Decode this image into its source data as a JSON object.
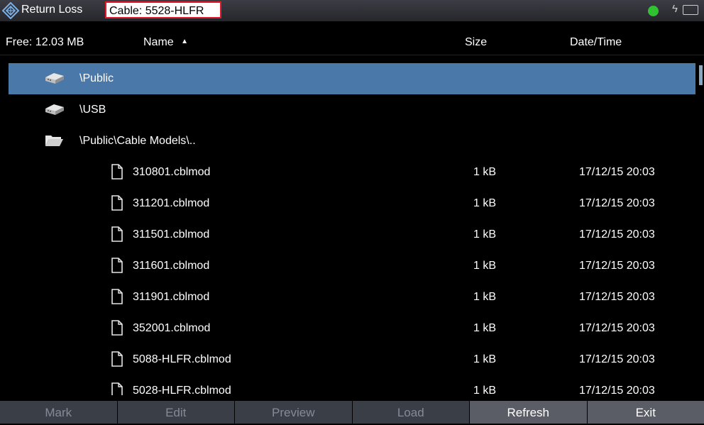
{
  "titlebar": {
    "app_name": "Return Loss",
    "cable": "Cable: 5528-HLFR",
    "status_color": "#30c230",
    "bolt_glyph": "ϟ"
  },
  "header": {
    "free_space": "Free: 12.03 MB",
    "col_name": "Name",
    "sort_glyph": "▲",
    "col_size": "Size",
    "col_datetime": "Date/Time"
  },
  "folders": [
    {
      "name": "\\Public",
      "icon": "drive-icon",
      "selected": true
    },
    {
      "name": "\\USB",
      "icon": "drive-icon",
      "selected": false
    },
    {
      "name": "\\Public\\Cable Models\\..",
      "icon": "open-folder-icon",
      "selected": false
    }
  ],
  "files": [
    {
      "name": "310801.cblmod",
      "size": "1 kB",
      "date": "17/12/15 20:03"
    },
    {
      "name": "311201.cblmod",
      "size": "1 kB",
      "date": "17/12/15 20:03"
    },
    {
      "name": "311501.cblmod",
      "size": "1 kB",
      "date": "17/12/15 20:03"
    },
    {
      "name": "311601.cblmod",
      "size": "1 kB",
      "date": "17/12/15 20:03"
    },
    {
      "name": "311901.cblmod",
      "size": "1 kB",
      "date": "17/12/15 20:03"
    },
    {
      "name": "352001.cblmod",
      "size": "1 kB",
      "date": "17/12/15 20:03"
    },
    {
      "name": "5088-HLFR.cblmod",
      "size": "1 kB",
      "date": "17/12/15 20:03"
    },
    {
      "name": "5028-HLFR.cblmod",
      "size": "1 kB",
      "date": "17/12/15 20:03"
    }
  ],
  "softkeys": [
    {
      "label": "Mark",
      "enabled": false
    },
    {
      "label": "Edit",
      "enabled": false
    },
    {
      "label": "Preview",
      "enabled": false
    },
    {
      "label": "Load",
      "enabled": false
    },
    {
      "label": "Refresh",
      "enabled": true
    },
    {
      "label": "Exit",
      "enabled": true
    }
  ]
}
